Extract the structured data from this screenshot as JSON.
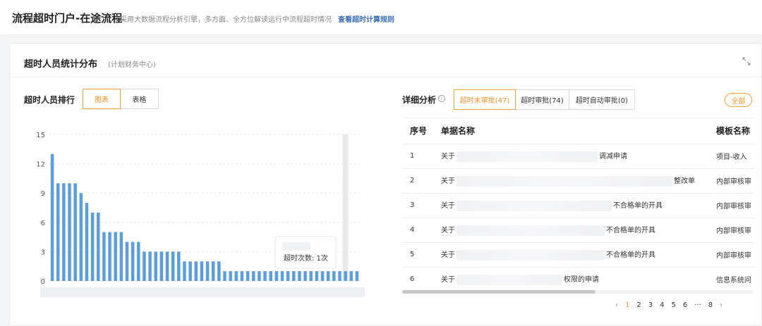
{
  "header": {
    "title": "流程超时门户-在途流程",
    "description": "采用大数据流程分析引擎，多方面、全方位解读运行中流程超时情况",
    "rule_link": "查看超时计算规则"
  },
  "card": {
    "title": "超时人员统计分布",
    "subtitle": "(计划财务中心)"
  },
  "left_panel": {
    "title": "超时人员排行",
    "view_toggle": [
      {
        "label": "图表",
        "active": true
      },
      {
        "label": "表格",
        "active": false
      }
    ]
  },
  "right_panel": {
    "title": "详细分析",
    "tabs": [
      {
        "label": "超时未审批(47)",
        "active": true
      },
      {
        "label": "超时审批(74)",
        "active": false
      },
      {
        "label": "超时自动审批(0)",
        "active": false
      }
    ],
    "all_button": "全部",
    "table": {
      "columns": [
        "序号",
        "单据名称",
        "模板名称"
      ],
      "rows": [
        {
          "index": "1",
          "prefix": "关于",
          "suffix": "调减申请",
          "template": "项目-收入"
        },
        {
          "index": "2",
          "prefix": "关于",
          "suffix": "整改单",
          "template": "内部审核审"
        },
        {
          "index": "3",
          "prefix": "关于",
          "suffix": "不合格单的开具",
          "template": "内部审核审"
        },
        {
          "index": "4",
          "prefix": "关于",
          "suffix": "不合格单的开具",
          "template": "内部审核审"
        },
        {
          "index": "5",
          "prefix": "关于",
          "suffix": "不合格单的开具",
          "template": "内部审核审"
        },
        {
          "index": "6",
          "prefix": "关于",
          "suffix": "权限的申请",
          "template": "信息系统问"
        }
      ]
    },
    "pagination": {
      "prev": "‹",
      "pages": [
        "1",
        "2",
        "3",
        "4",
        "5",
        "6"
      ],
      "ellipsis": "···",
      "last": "8",
      "next": "›",
      "current": "1"
    }
  },
  "chart_data": {
    "type": "bar",
    "ylim": [
      0,
      15
    ],
    "yticks": [
      0,
      3,
      6,
      9,
      12,
      15
    ],
    "values": [
      13,
      10,
      10,
      10,
      10,
      9,
      8,
      7,
      7,
      5,
      5,
      5,
      5,
      4,
      4,
      4,
      3,
      3,
      3,
      3,
      3,
      3,
      3,
      2,
      2,
      2,
      2,
      2,
      2,
      2,
      1,
      1,
      1,
      1,
      1,
      1,
      1,
      1,
      1,
      1,
      1,
      1,
      1,
      1,
      1,
      1,
      1,
      1,
      1,
      1,
      1,
      1,
      1,
      1
    ],
    "highlight_index": 51,
    "tooltip": "超时次数: 1次",
    "bar_color": "#5b9ee0",
    "grid": true
  },
  "colors": {
    "accent": "#f0932a",
    "link": "#3b6fb6",
    "bar": "#5b9ee0"
  }
}
